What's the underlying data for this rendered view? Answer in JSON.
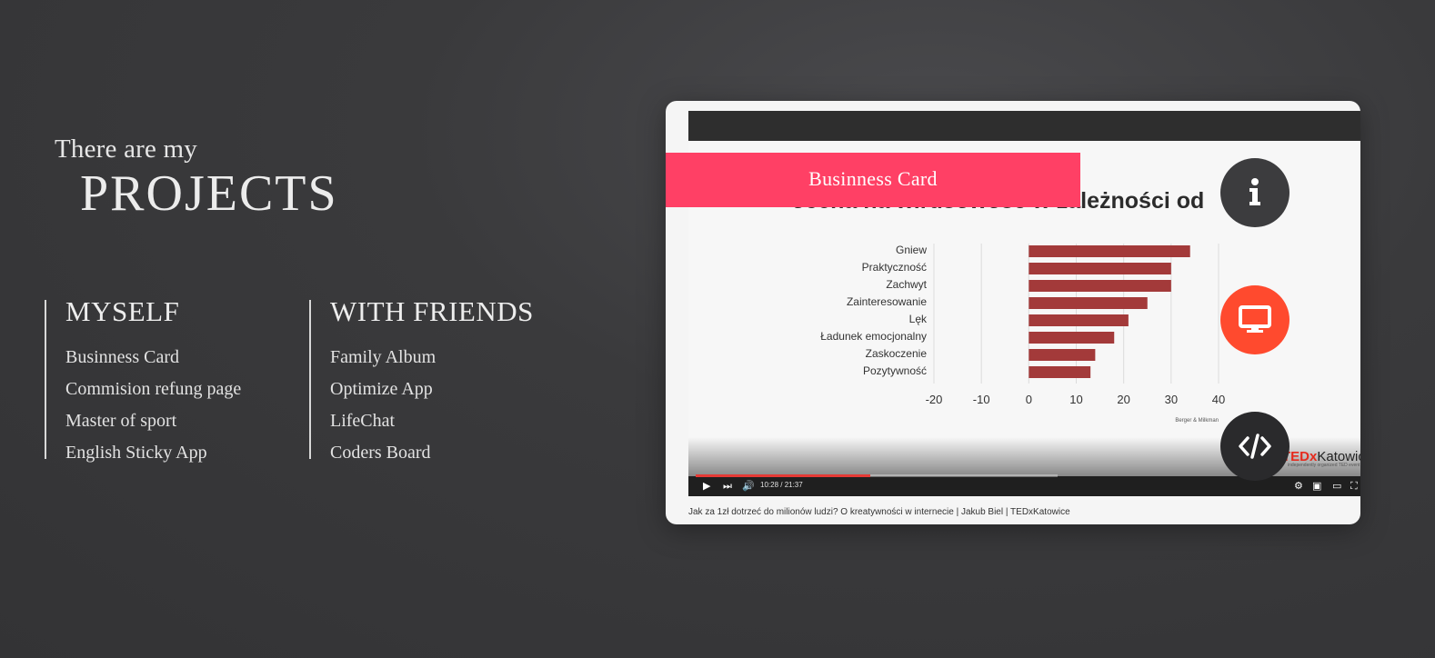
{
  "intro": {
    "small": "There are my",
    "big": "PROJECTS"
  },
  "myself": {
    "heading": "MYSELF",
    "items": [
      "Businness Card",
      "Commision refung page",
      "Master of sport",
      "English Sticky App"
    ]
  },
  "friends": {
    "heading": "WITH FRIENDS",
    "items": [
      "Family Album",
      "Optimize App",
      "LifeChat",
      "Coders Board"
    ]
  },
  "preview": {
    "project_title": "Businness Card",
    "slide_title": "ocena na wirusowość w zależności od",
    "player_time": "10:28 / 21:37",
    "progress": 0.4822,
    "caption": "Jak za 1zł dotrzeć do milionów ludzi? O kreatywności w internecie | Jakub Biel | TEDxKatowice",
    "brand_prefix": "TED",
    "brand_x": "x",
    "brand_city": "Katowice",
    "brand_sub": "independently organized TED event",
    "chart_data": {
      "type": "bar",
      "orientation": "horizontal",
      "categories": [
        "Gniew",
        "Praktyczność",
        "Zachwyt",
        "Zainteresowanie",
        "Lęk",
        "Ładunek emocjonalny",
        "Zaskoczenie",
        "Pozytywność"
      ],
      "values": [
        34,
        30,
        30,
        25,
        21,
        18,
        14,
        13
      ],
      "ticks": [
        -20,
        -10,
        0,
        10,
        20,
        30,
        40
      ],
      "xlim": [
        -20,
        40
      ],
      "source": "Berger & Milkman",
      "color": "#a33a3a"
    }
  },
  "colors": {
    "accent": "#ff4065",
    "demo_button": "#ff4a2e"
  },
  "icons": {
    "info": "info-icon",
    "demo": "monitor-icon",
    "code": "code-icon"
  }
}
